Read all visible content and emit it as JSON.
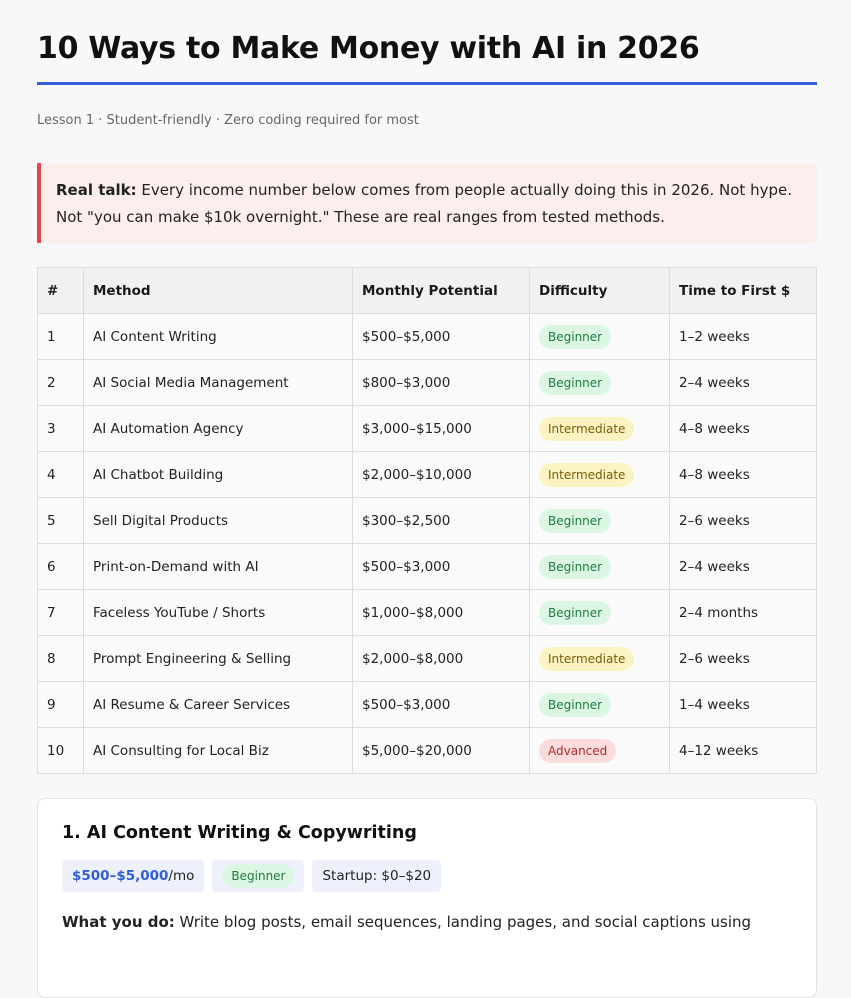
{
  "header": {
    "title": "10 Ways to Make Money with AI in 2026",
    "meta": "Lesson 1 · Student-friendly · Zero coding required for most"
  },
  "callout": {
    "label": "Real talk:",
    "text": "Every income number below comes from people actually doing this in 2026. Not hype. Not \"you can make $10k overnight.\" These are real ranges from tested methods."
  },
  "table": {
    "headers": [
      "#",
      "Method",
      "Monthly Potential",
      "Difficulty",
      "Time to First $"
    ],
    "rows": [
      {
        "n": "1",
        "method": "AI Content Writing",
        "potential": "$500–$5,000",
        "difficulty": "Beginner",
        "time": "1–2 weeks"
      },
      {
        "n": "2",
        "method": "AI Social Media Management",
        "potential": "$800–$3,000",
        "difficulty": "Beginner",
        "time": "2–4 weeks"
      },
      {
        "n": "3",
        "method": "AI Automation Agency",
        "potential": "$3,000–$15,000",
        "difficulty": "Intermediate",
        "time": "4–8 weeks"
      },
      {
        "n": "4",
        "method": "AI Chatbot Building",
        "potential": "$2,000–$10,000",
        "difficulty": "Intermediate",
        "time": "4–8 weeks"
      },
      {
        "n": "5",
        "method": "Sell Digital Products",
        "potential": "$300–$2,500",
        "difficulty": "Beginner",
        "time": "2–6 weeks"
      },
      {
        "n": "6",
        "method": "Print-on-Demand with AI",
        "potential": "$500–$3,000",
        "difficulty": "Beginner",
        "time": "2–4 weeks"
      },
      {
        "n": "7",
        "method": "Faceless YouTube / Shorts",
        "potential": "$1,000–$8,000",
        "difficulty": "Beginner",
        "time": "2–4 months"
      },
      {
        "n": "8",
        "method": "Prompt Engineering & Selling",
        "potential": "$2,000–$8,000",
        "difficulty": "Intermediate",
        "time": "2–6 weeks"
      },
      {
        "n": "9",
        "method": "AI Resume & Career Services",
        "potential": "$500–$3,000",
        "difficulty": "Beginner",
        "time": "1–4 weeks"
      },
      {
        "n": "10",
        "method": "AI Consulting for Local Biz",
        "potential": "$5,000–$20,000",
        "difficulty": "Advanced",
        "time": "4–12 weeks"
      }
    ]
  },
  "card": {
    "title": "1. AI Content Writing & Copywriting",
    "income_amount": "$500–$5,000",
    "income_unit": "/mo",
    "difficulty": "Beginner",
    "startup": "Startup: $0–$20",
    "what_label": "What you do:",
    "what_text": "Write blog posts, email sequences, landing pages, and social captions using"
  },
  "colors": {
    "accent": "#2f5fd6",
    "callout_border": "#e04848",
    "callout_bg": "#fdeeee",
    "beginner": "#dcf6e4",
    "intermediate": "#fbf3c2",
    "advanced": "#fbdcdc"
  }
}
